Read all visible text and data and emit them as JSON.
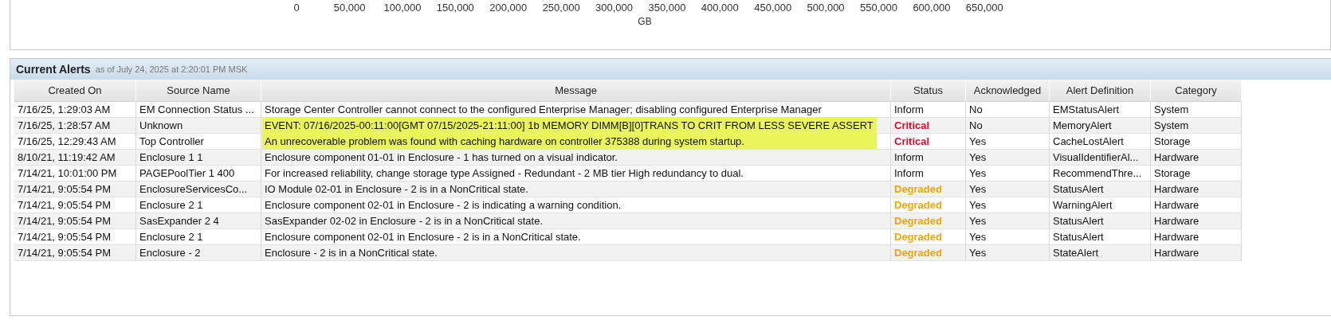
{
  "axis": {
    "tick_labels": [
      "0",
      "50,000",
      "100,000",
      "150,000",
      "200,000",
      "250,000",
      "300,000",
      "350,000",
      "400,000",
      "450,000",
      "500,000",
      "550,000",
      "600,000",
      "650,000"
    ],
    "title": "GB"
  },
  "alerts": {
    "title": "Current Alerts",
    "subtitle": "as of July 24, 2025 at 2:20:01 PM MSK",
    "columns": [
      "Created On",
      "Source Name",
      "Message",
      "Status",
      "Acknowledged",
      "Alert Definition",
      "Category"
    ],
    "rows": [
      {
        "created_on": "7/16/25, 1:29:03 AM",
        "source_name": "EM Connection Status ...",
        "message": "Storage Center Controller cannot connect to the configured Enterprise Manager; disabling configured Enterprise Manager",
        "highlighted": false,
        "status": "Inform",
        "color": "#111111",
        "acknowledged": "No",
        "alert_definition": "EMStatusAlert",
        "category": "System"
      },
      {
        "created_on": "7/16/25, 1:28:57 AM",
        "source_name": "Unknown",
        "message": "EVENT: 07/16/2025-00:11:00[GMT 07/15/2025-21:11:00] 1b MEMORY DIMM[B][0]TRANS TO CRIT FROM LESS SEVERE ASSERT",
        "highlighted": true,
        "status": "Critical",
        "color": "#d0102c",
        "acknowledged": "No",
        "alert_definition": "MemoryAlert",
        "category": "System"
      },
      {
        "created_on": "7/16/25, 12:29:43 AM",
        "source_name": "Top Controller",
        "message": "An unrecoverable problem was found with caching hardware on controller 375388 during system startup.",
        "highlighted": true,
        "status": "Critical",
        "color": "#d0102c",
        "acknowledged": "Yes",
        "alert_definition": "CacheLostAlert",
        "category": "Storage"
      },
      {
        "created_on": "8/10/21, 11:19:42 AM",
        "source_name": "Enclosure 1 1",
        "message": "Enclosure component 01-01 in Enclosure - 1 has turned on a visual indicator.",
        "highlighted": false,
        "status": "Inform",
        "color": "#111111",
        "acknowledged": "Yes",
        "alert_definition": "VisualIdentifierAl...",
        "category": "Hardware"
      },
      {
        "created_on": "7/14/21, 10:01:00 PM",
        "source_name": "PAGEPoolTier 1 400",
        "message": "For increased reliability, change storage type Assigned - Redundant - 2 MB tier High redundancy to dual.",
        "highlighted": false,
        "status": "Inform",
        "color": "#111111",
        "acknowledged": "Yes",
        "alert_definition": "RecommendThre...",
        "category": "Storage"
      },
      {
        "created_on": "7/14/21, 9:05:54 PM",
        "source_name": "EnclosureServicesCo...",
        "message": "IO Module 02-01 in Enclosure - 2 is in a NonCritical state.",
        "highlighted": false,
        "status": "Degraded",
        "color": "#f0a800",
        "acknowledged": "Yes",
        "alert_definition": "StatusAlert",
        "category": "Hardware"
      },
      {
        "created_on": "7/14/21, 9:05:54 PM",
        "source_name": "Enclosure 2 1",
        "message": "Enclosure component 02-01 in Enclosure - 2 is indicating a warning condition.",
        "highlighted": false,
        "status": "Degraded",
        "color": "#f0a800",
        "acknowledged": "Yes",
        "alert_definition": "WarningAlert",
        "category": "Hardware"
      },
      {
        "created_on": "7/14/21, 9:05:54 PM",
        "source_name": "SasExpander 2 4",
        "message": "SasExpander 02-02 in Enclosure - 2 is in a NonCritical state.",
        "highlighted": false,
        "status": "Degraded",
        "color": "#f0a800",
        "acknowledged": "Yes",
        "alert_definition": "StatusAlert",
        "category": "Hardware"
      },
      {
        "created_on": "7/14/21, 9:05:54 PM",
        "source_name": "Enclosure 2 1",
        "message": "Enclosure component 02-01 in Enclosure - 2 is in a NonCritical state.",
        "highlighted": false,
        "status": "Degraded",
        "color": "#f0a800",
        "acknowledged": "Yes",
        "alert_definition": "StatusAlert",
        "category": "Hardware"
      },
      {
        "created_on": "7/14/21, 9:05:54 PM",
        "source_name": "Enclosure - 2",
        "message": "Enclosure - 2 is in a NonCritical state.",
        "highlighted": false,
        "status": "Degraded",
        "color": "#f0a800",
        "acknowledged": "Yes",
        "alert_definition": "StateAlert",
        "category": "Hardware"
      }
    ]
  }
}
